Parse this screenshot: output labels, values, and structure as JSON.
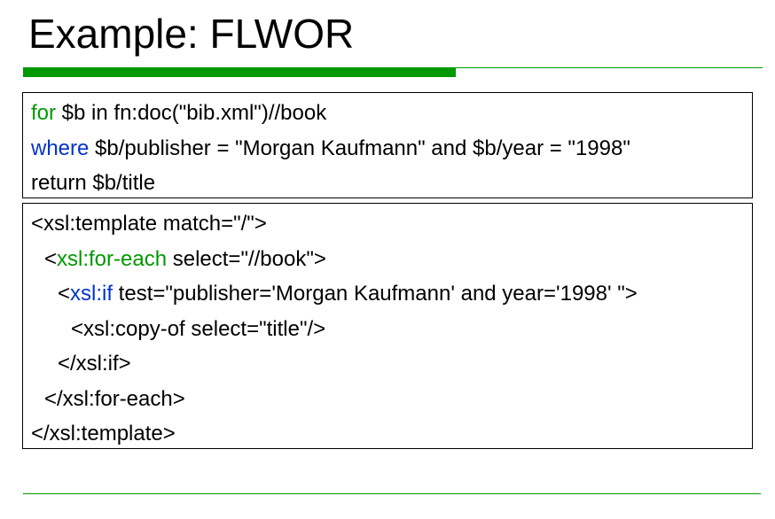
{
  "slide": {
    "title": "Example: FLWOR"
  },
  "flwor": {
    "lines": [
      {
        "keyword": "for",
        "rest": " $b in fn:doc(\"bib.xml\")//book"
      },
      {
        "keyword": "where",
        "rest": " $b/publisher = \"Morgan Kaufmann\" and $b/year = \"1998\""
      },
      {
        "keyword": "",
        "rest": "return $b/title"
      }
    ]
  },
  "xsl": {
    "line1": "<xsl:template match=\"/\">",
    "line2": {
      "pre": "<",
      "keyword": "xsl:for-each",
      "rest": " select=\"//book\">"
    },
    "line3": {
      "pre": "<",
      "keyword": "xsl:if",
      "rest": " test=\"publisher='Morgan Kaufmann' and year='1998' \">"
    },
    "line4": "<xsl:copy-of select=\"title\"/>",
    "line5": "</xsl:if>",
    "line6": "</xsl:for-each>",
    "line7": "</xsl:template>"
  },
  "colors": {
    "accent_green": "#009900",
    "keyword_blue": "#0033cc"
  }
}
